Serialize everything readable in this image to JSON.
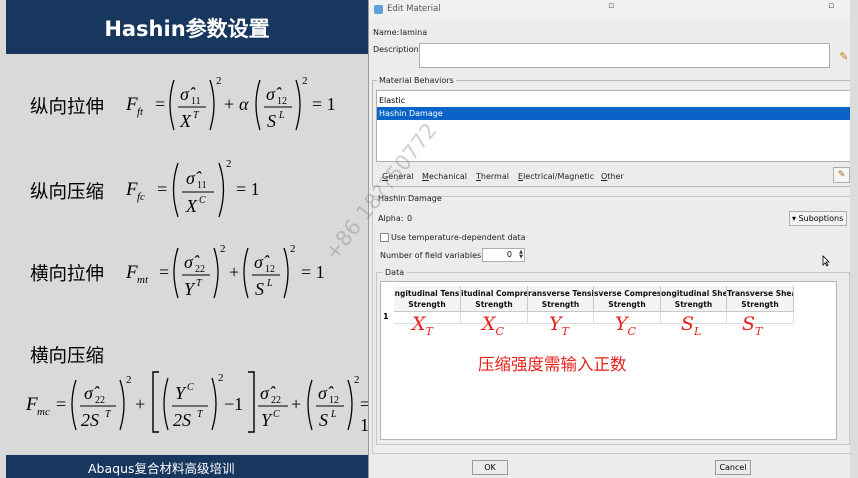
{
  "slide": {
    "title": "Hashin参数设置",
    "footer": "Abaqus复合材料高级培训",
    "rows": [
      {
        "label": "纵向拉伸",
        "lhs": "F",
        "lhs_sub": "ft"
      },
      {
        "label": "纵向压缩",
        "lhs": "F",
        "lhs_sub": "fc"
      },
      {
        "label": "横向拉伸",
        "lhs": "F",
        "lhs_sub": "mt"
      },
      {
        "label": "横向压缩",
        "lhs": "F",
        "lhs_sub": "mc"
      }
    ],
    "formula_text": {
      "sigma": "σ̂",
      "sub11": "11",
      "sub12": "12",
      "sub22": "22",
      "X": "X",
      "Y": "Y",
      "S": "S",
      "supT": "T",
      "supC": "C",
      "supL": "L",
      "two": "2",
      "two_S": "2S",
      "alpha": "α",
      "plus": "+",
      "minus": "−1",
      "eq": "=",
      "one": "1",
      "eq1": "= 1"
    }
  },
  "dialog": {
    "title": "Edit Material",
    "name_label": "Name:",
    "name_value": "lamina",
    "description_label": "Description:",
    "behaviors_label": "Material Behaviors",
    "behaviors": [
      "Elastic",
      "Hashin Damage"
    ],
    "selected_behavior": "Hashin Damage",
    "menu": [
      {
        "label": "General",
        "underline": "G",
        "rest": "eneral"
      },
      {
        "label": "Mechanical",
        "underline": "M",
        "rest": "echanical"
      },
      {
        "label": "Thermal",
        "underline": "T",
        "rest": "hermal"
      },
      {
        "label": "Electrical/Magnetic",
        "underline": "E",
        "rest": "lectrical/Magnetic"
      },
      {
        "label": "Other",
        "underline": "O",
        "rest": "ther"
      }
    ],
    "section_title": "Hashin Damage",
    "alpha_label": "Alpha:",
    "alpha_value": "0",
    "suboptions_label": "▾ Suboptions",
    "use_temp_label": "Use temperature-dependent data",
    "field_vars_label": "Number of field variables:",
    "field_vars_value": "0",
    "data_label": "Data",
    "table_headers": [
      [
        "ngitudinal Tens",
        "Strength"
      ],
      [
        "itudinal Compre",
        "Strength"
      ],
      [
        "ransverse Tensi",
        "Strength"
      ],
      [
        "sverse Compres",
        "Strength"
      ],
      [
        "ongitudinal She",
        "Strength"
      ],
      [
        "Transverse Shea",
        "Strength"
      ]
    ],
    "row_number": "1",
    "annotations": [
      {
        "base": "X",
        "sub": "T"
      },
      {
        "base": "X",
        "sub": "C"
      },
      {
        "base": "Y",
        "sub": "T"
      },
      {
        "base": "Y",
        "sub": "C"
      },
      {
        "base": "S",
        "sub": "L"
      },
      {
        "base": "S",
        "sub": "T"
      }
    ],
    "annotation_note": "压缩强度需输入正数",
    "ok_label": "OK",
    "cancel_label": "Cancel"
  },
  "watermark": "+86 18??50772",
  "colors": {
    "title_bar": "#17375e",
    "selection": "#0a64c8",
    "annotation": "#e8201c"
  }
}
